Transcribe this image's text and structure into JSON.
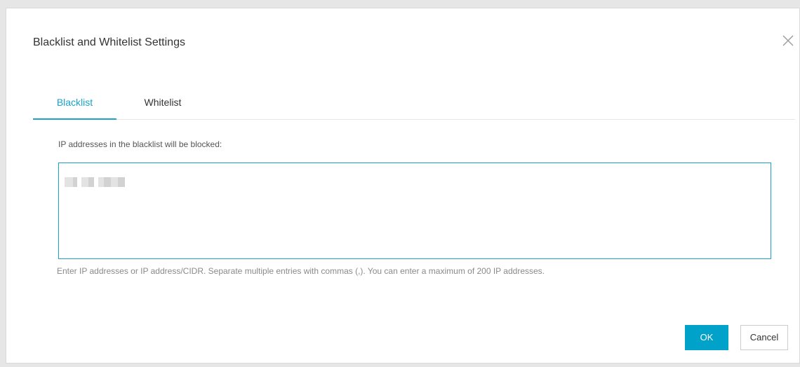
{
  "dialog": {
    "title": "Blacklist and Whitelist Settings",
    "close_icon": "close-icon"
  },
  "tabs": [
    {
      "label": "Blacklist",
      "active": true
    },
    {
      "label": "Whitelist",
      "active": false
    }
  ],
  "blacklist": {
    "label": "IP addresses in the blacklist will be blocked:",
    "value_redacted": true,
    "help": "Enter IP addresses or IP address/CIDR. Separate multiple entries with commas (,). You can enter a maximum of 200 IP addresses."
  },
  "footer": {
    "ok_label": "OK",
    "cancel_label": "Cancel"
  },
  "colors": {
    "accent": "#00a2ca",
    "tab_active": "#1aa3c8",
    "border": "#d9d9d9"
  }
}
